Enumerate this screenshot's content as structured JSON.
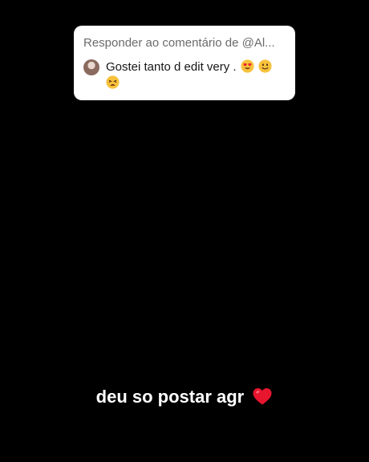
{
  "reply_card": {
    "header": "Responder ao comentário de @Al...",
    "comment_text": "Gostei tanto d edit very .",
    "emojis": [
      "heart-eyes-emoji",
      "slightly-smiling-emoji",
      "tired-face-emoji"
    ]
  },
  "caption": {
    "text": "deu so postar agr",
    "emoji": "red-heart-emoji"
  },
  "colors": {
    "background": "#000000",
    "card": "#ffffff",
    "header_text": "#6b6b6b",
    "heart": "#e8152f"
  }
}
